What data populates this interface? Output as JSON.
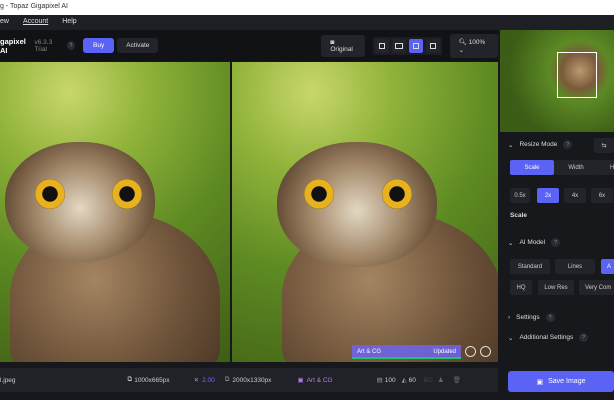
{
  "window": {
    "title": "g - Topaz Gigapixel AI"
  },
  "menu": [
    "ew",
    "Account",
    "Help"
  ],
  "toolbar": {
    "app_name": "gapixel AI",
    "version": "v6.3.3 Trial",
    "help": "?",
    "buy": "Buy",
    "activate": "Activate",
    "original": "Original",
    "zoom": "100%"
  },
  "overlay": {
    "model": "Art & CG",
    "status": "Updated",
    "progress": 1.0
  },
  "bottom": {
    "filename": "l.jpeg",
    "input_size": "1000x665px",
    "scale": "2.00",
    "output_size": "2000x1330px",
    "model": "Art & CG",
    "quality": "100",
    "sharpen": "60",
    "extra": "BC"
  },
  "panel": {
    "resize_mode": "Resize Mode",
    "help": "?",
    "resize_tabs": [
      "Scale",
      "Width",
      "H"
    ],
    "scales": [
      "0.5x",
      "2x",
      "4x",
      "6x"
    ],
    "scale_label": "Scale",
    "ai_model": "AI Model",
    "models_row1": [
      "Standard",
      "Lines",
      "A"
    ],
    "models_row2": [
      "HQ",
      "Low Res",
      "Very Com"
    ],
    "settings": "Settings",
    "additional": "Additional Settings",
    "save": "Save Image"
  },
  "colors": {
    "accent": "#5b63f5",
    "progress": "#27c06a"
  }
}
